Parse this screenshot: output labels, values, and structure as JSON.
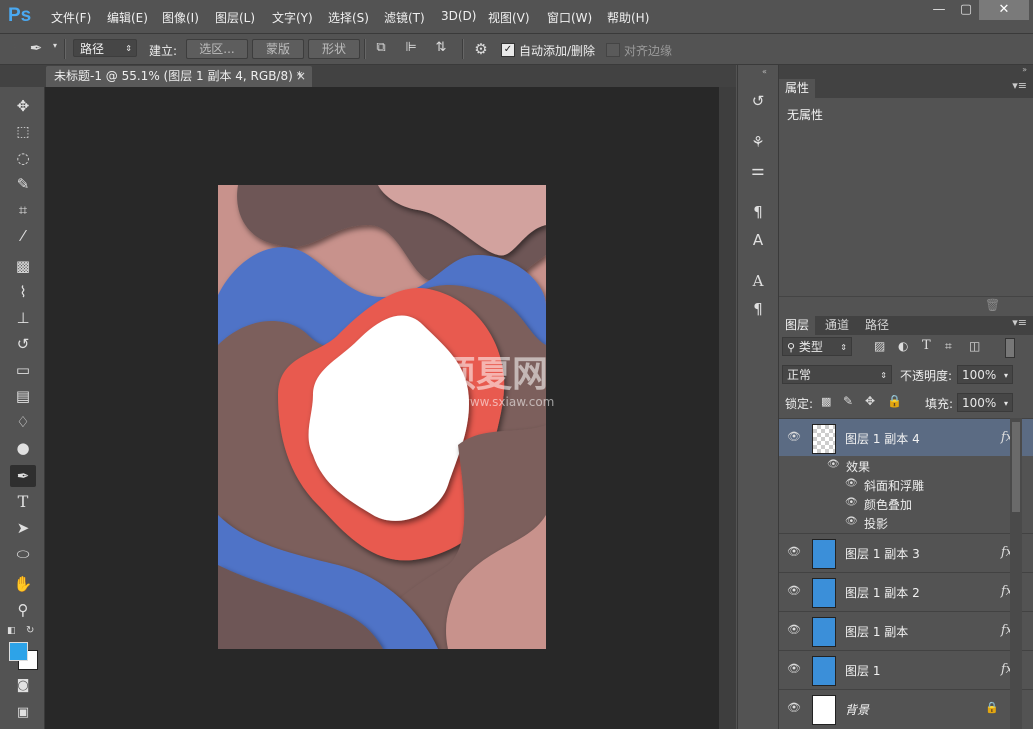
{
  "app": {
    "logo": "Ps"
  },
  "menu": [
    "文件(F)",
    "编辑(E)",
    "图像(I)",
    "图层(L)",
    "文字(Y)",
    "选择(S)",
    "滤镜(T)",
    "3D(D)",
    "视图(V)",
    "窗口(W)",
    "帮助(H)"
  ],
  "window_controls": {
    "minimize": "—",
    "maximize": "▢",
    "close": "✕"
  },
  "options": {
    "mode_value": "路径",
    "build_label": "建立:",
    "selection_btn": "选区...",
    "mask_btn": "蒙版",
    "shape_btn": "形状",
    "auto_add_delete": "自动添加/删除",
    "align_edges": "对齐边缘"
  },
  "document_tab": {
    "title": "未标题-1 @ 55.1% (图层 1 副本 4, RGB/8) *",
    "close": "×"
  },
  "watermark": {
    "main": "硕夏网",
    "sub": "www.sxiaw.com"
  },
  "properties": {
    "tab": "属性",
    "content": "无属性"
  },
  "layers": {
    "tabs": [
      "图层",
      "通道",
      "路径"
    ],
    "filter_kind": "类型",
    "blend_mode": "正常",
    "opacity_label": "不透明度:",
    "opacity_value": "100%",
    "lock_label": "锁定:",
    "fill_label": "填充:",
    "fill_value": "100%",
    "items": [
      {
        "name": "图层 1 副本 4",
        "fx": "fx",
        "selected": true
      },
      {
        "name": "图层 1 副本 3",
        "fx": "fx"
      },
      {
        "name": "图层 1 副本 2",
        "fx": "fx"
      },
      {
        "name": "图层 1 副本",
        "fx": "fx"
      },
      {
        "name": "图层 1",
        "fx": "fx"
      },
      {
        "name": "背景",
        "fx": ""
      }
    ],
    "effects_header": "效果",
    "effects": [
      "斜面和浮雕",
      "颜色叠加",
      "投影"
    ]
  },
  "colors": {
    "foreground": "#2da3e8",
    "background": "#ffffff",
    "canvas_bg": "#282828",
    "panel": "#535353",
    "selected_row": "#5b6b83"
  }
}
